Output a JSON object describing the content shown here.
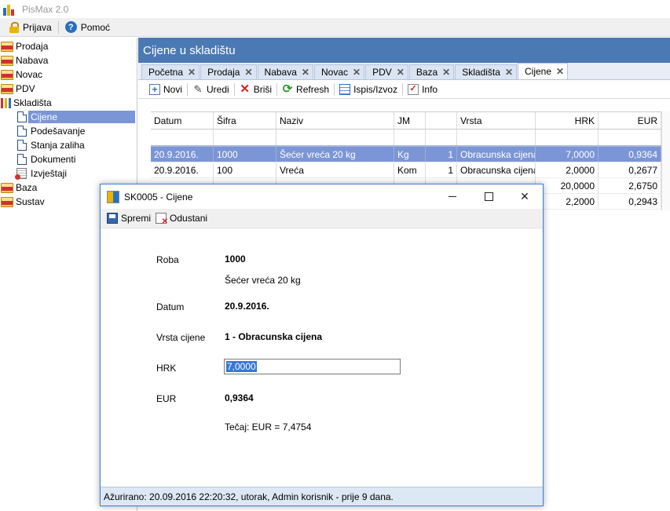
{
  "app": {
    "title": "PisMax 2.0"
  },
  "menu": {
    "login": "Prijava",
    "help": "Pomoć"
  },
  "tree": [
    {
      "label": "Prodaja",
      "level": 0,
      "icon": "folder-red-icon"
    },
    {
      "label": "Nabava",
      "level": 0,
      "icon": "folder-red-icon"
    },
    {
      "label": "Novac",
      "level": 0,
      "icon": "folder-red-icon"
    },
    {
      "label": "PDV",
      "level": 0,
      "icon": "folder-red-icon"
    },
    {
      "label": "Skladišta",
      "level": 0,
      "icon": "chart-icon"
    },
    {
      "label": "Cijene",
      "level": 1,
      "icon": "document-icon",
      "selected": true
    },
    {
      "label": "Podešavanje",
      "level": 1,
      "icon": "document-icon"
    },
    {
      "label": "Stanja zaliha",
      "level": 1,
      "icon": "document-icon"
    },
    {
      "label": "Dokumenti",
      "level": 1,
      "icon": "document-icon"
    },
    {
      "label": "Izvještaji",
      "level": 1,
      "icon": "report-icon"
    },
    {
      "label": "Baza",
      "level": 0,
      "icon": "folder-red-icon"
    },
    {
      "label": "Sustav",
      "level": 0,
      "icon": "folder-red-icon"
    }
  ],
  "main": {
    "title": "Cijene u skladištu",
    "tabs": [
      {
        "label": "Početna"
      },
      {
        "label": "Prodaja"
      },
      {
        "label": "Nabava"
      },
      {
        "label": "Novac"
      },
      {
        "label": "PDV"
      },
      {
        "label": "Baza"
      },
      {
        "label": "Skladišta"
      },
      {
        "label": "Cijene",
        "active": true
      }
    ],
    "tab_close": "✕",
    "toolbar": {
      "new": "Novi",
      "edit": "Uredi",
      "delete": "Briši",
      "refresh": "Refresh",
      "print": "Ispis/Izvoz",
      "info": "Info"
    },
    "grid": {
      "headers": {
        "datum": "Datum",
        "sifra": "Šifra",
        "naziv": "Naziv",
        "jm": "JM",
        "kol": "",
        "vrsta": "Vrsta",
        "hrk": "HRK",
        "eur": "EUR"
      },
      "rows": [
        {
          "datum": "20.9.2016.",
          "sifra": "1000",
          "naziv": "Šećer vreća 20 kg",
          "jm": "Kg",
          "kol": "1",
          "vrsta": "Obracunska cijena",
          "hrk": "7,0000",
          "eur": "0,9364",
          "selected": true
        },
        {
          "datum": "20.9.2016.",
          "sifra": "100",
          "naziv": "Vreća",
          "jm": "Kom",
          "kol": "1",
          "vrsta": "Obracunska cijena",
          "hrk": "2,0000",
          "eur": "0,2677"
        },
        {
          "datum": "",
          "sifra": "",
          "naziv": "",
          "jm": "",
          "kol": "",
          "vrsta": "",
          "hrk": "20,0000",
          "eur": "2,6750"
        },
        {
          "datum": "",
          "sifra": "",
          "naziv": "",
          "jm": "",
          "kol": "",
          "vrsta": "",
          "hrk": "2,2000",
          "eur": "0,2943"
        }
      ]
    }
  },
  "dialog": {
    "title": "SK0005 - Cijene",
    "toolbar": {
      "save": "Spremi",
      "cancel": "Odustani"
    },
    "fields": {
      "roba_label": "Roba",
      "roba_code": "1000",
      "roba_name": "Šećer vreća 20 kg",
      "datum_label": "Datum",
      "datum_value": "20.9.2016.",
      "vrsta_label": "Vrsta cijene",
      "vrsta_value": "1 - Obracunska cijena",
      "hrk_label": "HRK",
      "hrk_value": "7,0000",
      "eur_label": "EUR",
      "eur_value": "0,9364",
      "tecaj": "Tečaj: EUR = 7,4754"
    },
    "status": "Ažurirano: 20.09.2016 22:20:32, utorak, Admin korisnik -  prije 9 dana."
  }
}
